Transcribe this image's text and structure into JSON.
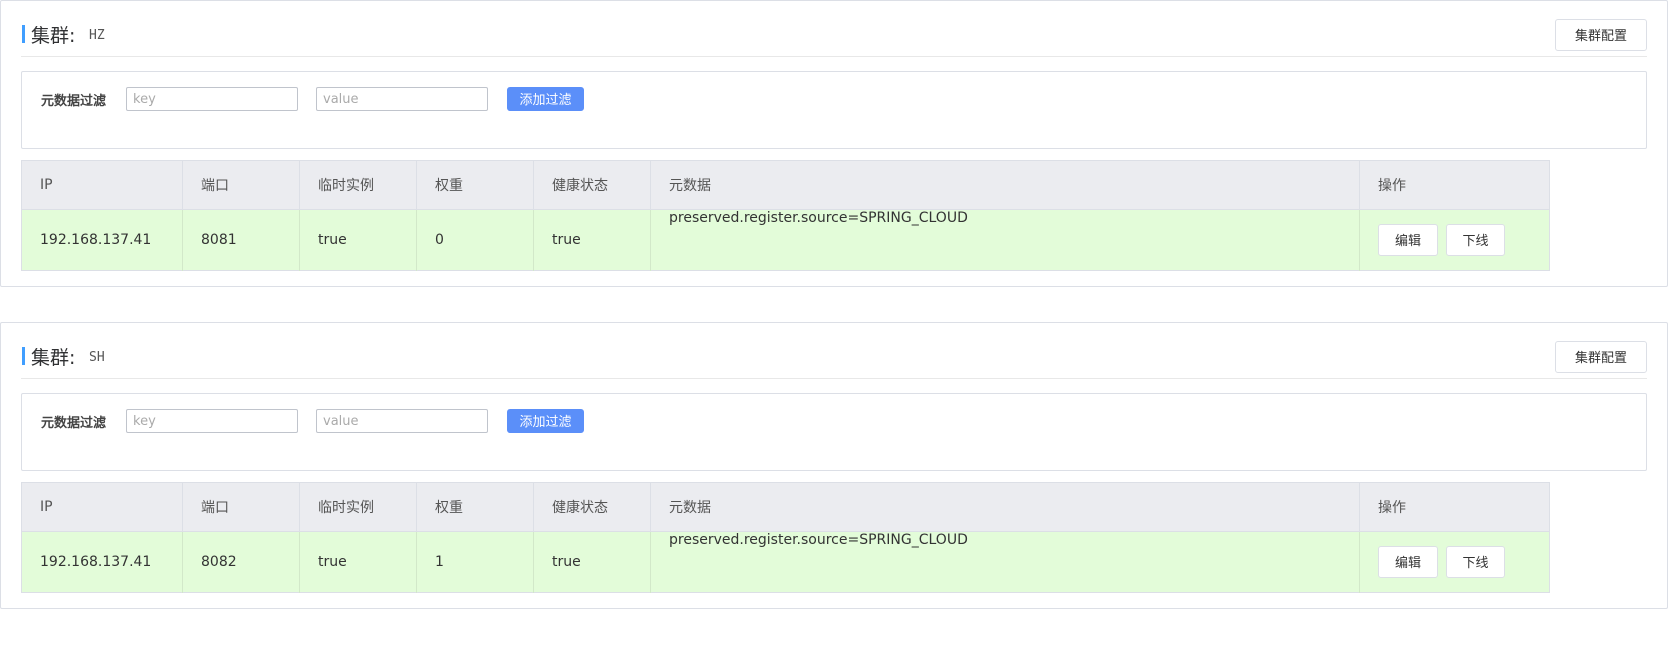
{
  "clusters": [
    {
      "title": "集群:",
      "name": "HZ",
      "config_label": "集群配置",
      "filter": {
        "label": "元数据过滤",
        "key_placeholder": "key",
        "value_placeholder": "value",
        "add_label": "添加过滤"
      },
      "columns": [
        "IP",
        "端口",
        "临时实例",
        "权重",
        "健康状态",
        "元数据",
        "操作"
      ],
      "rows": [
        {
          "ip": "192.168.137.41",
          "port": "8081",
          "ephemeral": "true",
          "weight": "0",
          "healthy": "true",
          "metadata": "preserved.register.source=SPRING_CLOUD",
          "edit_label": "编辑",
          "offline_label": "下线"
        }
      ]
    },
    {
      "title": "集群:",
      "name": "SH",
      "config_label": "集群配置",
      "filter": {
        "label": "元数据过滤",
        "key_placeholder": "key",
        "value_placeholder": "value",
        "add_label": "添加过滤"
      },
      "columns": [
        "IP",
        "端口",
        "临时实例",
        "权重",
        "健康状态",
        "元数据",
        "操作"
      ],
      "rows": [
        {
          "ip": "192.168.137.41",
          "port": "8082",
          "ephemeral": "true",
          "weight": "1",
          "healthy": "true",
          "metadata": "preserved.register.source=SPRING_CLOUD",
          "edit_label": "编辑",
          "offline_label": "下线"
        }
      ]
    }
  ],
  "colors": {
    "accent": "#409eff",
    "button_primary": "#5b8ff9",
    "row_bg": "#e3fcd9",
    "header_bg": "#ebecf0"
  }
}
